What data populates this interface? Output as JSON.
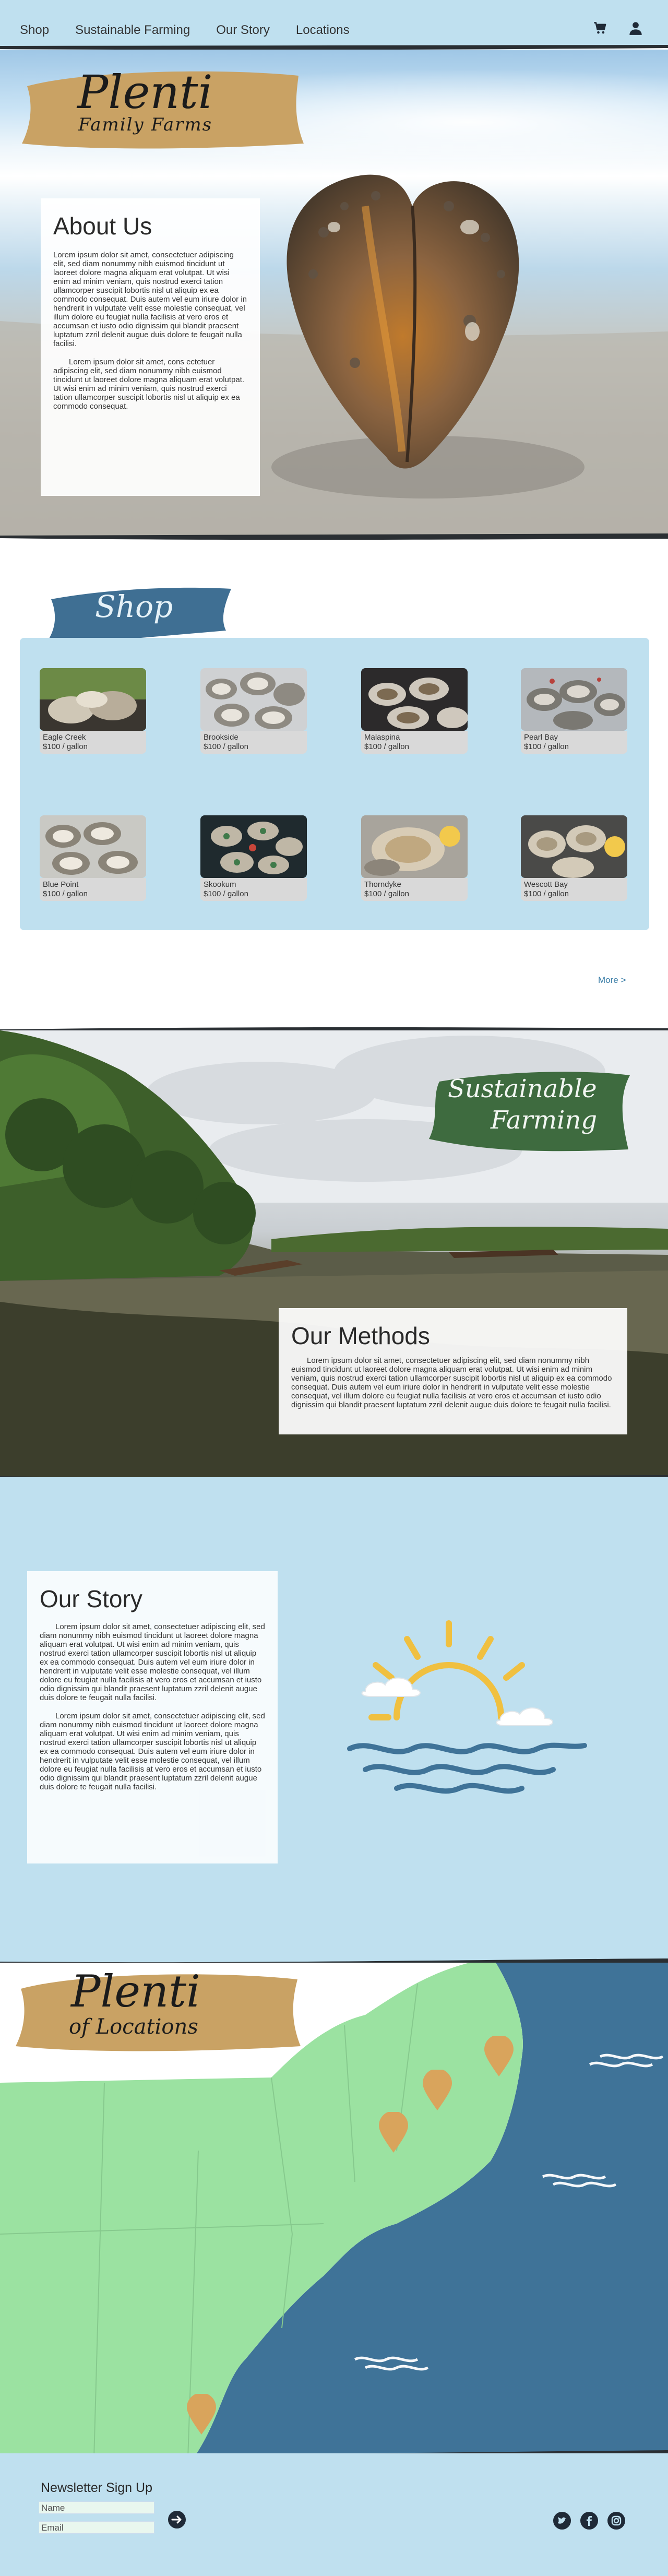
{
  "nav": {
    "links": [
      "Shop",
      "Sustainable Farming",
      "Our Story",
      "Locations"
    ],
    "icons": [
      "cart-icon",
      "user-icon"
    ]
  },
  "hero": {
    "brand": "Plenti",
    "brand_sub": "Family Farms",
    "about_title": "About Us",
    "about_p1": "Lorem ipsum dolor sit amet, consectetuer adipiscing elit, sed diam nonummy nibh euismod tincidunt ut laoreet dolore magna aliquam erat volutpat. Ut wisi enim ad minim veniam, quis nostrud exerci tation ullamcorper suscipit lobortis nisl ut aliquip ex ea commodo consequat. Duis autem vel eum iriure dolor in hendrerit in vulputate velit esse molestie consequat, vel illum dolore eu feugiat nulla facilisis at vero eros et accumsan et iusto odio dignissim qui blandit praesent luptatum zzril delenit augue duis dolore te feugait nulla facilisi.",
    "about_p2": "Lorem ipsum dolor sit amet, cons ectetuer adipiscing elit, sed diam nonummy nibh euismod tincidunt ut laoreet dolore magna aliquam erat volutpat. Ut wisi enim ad minim veniam, quis nostrud exerci tation ullamcorper suscipit lobortis nisl ut aliquip ex ea commodo consequat."
  },
  "shop": {
    "title": "Shop",
    "products": [
      {
        "name": "Eagle Creek",
        "price": "$100 / gallon"
      },
      {
        "name": "Brookside",
        "price": "$100 / gallon"
      },
      {
        "name": "Malaspina",
        "price": "$100 / gallon"
      },
      {
        "name": "Pearl Bay",
        "price": "$100 / gallon"
      },
      {
        "name": "Blue Point",
        "price": "$100 / gallon"
      },
      {
        "name": "Skookum",
        "price": "$100 / gallon"
      },
      {
        "name": "Thorndyke",
        "price": "$100 / gallon"
      },
      {
        "name": "Wescott Bay",
        "price": "$100 / gallon"
      }
    ],
    "more": "More >"
  },
  "methods": {
    "banner": "Sustainable",
    "banner2": "Farming",
    "title": "Our Methods",
    "body": "Lorem ipsum dolor sit amet, consectetuer adipiscing elit, sed diam nonummy nibh euismod tincidunt ut laoreet dolore magna aliquam erat volutpat. Ut wisi enim ad minim veniam, quis nostrud exerci tation ullamcorper suscipit lobortis nisl ut aliquip ex ea commodo consequat. Duis autem vel eum iriure dolor in hendrerit in vulputate velit esse molestie consequat, vel illum dolore eu feugiat nulla facilisis at vero eros et accumsan et iusto odio dignissim qui blandit praesent luptatum zzril delenit augue duis dolore te feugait nulla facilisi."
  },
  "story": {
    "title": "Our Story",
    "p1": "Lorem ipsum dolor sit amet, consectetuer adipiscing elit, sed diam nonummy nibh euismod tincidunt ut laoreet dolore magna aliquam erat volutpat. Ut wisi enim ad minim veniam, quis nostrud exerci tation ullamcorper suscipit lobortis nisl ut aliquip ex ea commodo consequat. Duis autem vel eum iriure dolor in hendrerit in vulputate velit esse molestie consequat, vel illum dolore eu feugiat nulla facilisis at vero eros et accumsan et iusto odio dignissim qui blandit praesent luptatum zzril delenit augue duis dolore te feugait nulla facilisi.",
    "p2": "Lorem ipsum dolor sit amet, consectetuer adipiscing elit, sed diam nonummy nibh euismod tincidunt ut laoreet dolore magna aliquam erat volutpat. Ut wisi enim ad minim veniam, quis nostrud exerci tation ullamcorper suscipit lobortis nisl ut aliquip ex ea commodo consequat. Duis autem vel eum iriure dolor in hendrerit in vulputate velit esse molestie consequat, vel illum dolore eu feugiat nulla facilisis at vero eros et accumsan et iusto odio dignissim qui blandit praesent luptatum zzril delenit augue duis dolore te feugait nulla facilisi."
  },
  "locations": {
    "brand": "Plenti",
    "sub": "of Locations"
  },
  "footer": {
    "title": "Newsletter Sign Up",
    "name_placeholder": "Name",
    "email_placeholder": "Email",
    "social": [
      "twitter-icon",
      "facebook-icon",
      "instagram-icon"
    ]
  },
  "colors": {
    "nav_bg": "#bfe0ef",
    "gold_brush": "#c9a264",
    "blue_brush": "#3f6f93",
    "green_brush": "#3e6b3f",
    "ocean": "#3f7398",
    "land": "#9be2a1",
    "pin": "#d9a45c"
  }
}
